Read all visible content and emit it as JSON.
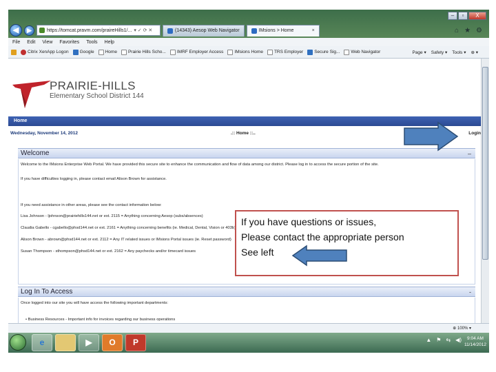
{
  "window": {
    "minimize": "–",
    "restore": "▫",
    "close": "X"
  },
  "toolbar": {
    "back": "◀",
    "forward": "▶",
    "address": "https://tomcat.pravm.com/praireHills1/...",
    "address_controls": "▾ ✓ ⟳ ✕",
    "tabs": [
      {
        "label": "(14343) Aesop Web Navigator",
        "close": ""
      },
      {
        "label": "IMsions > Home",
        "close": "×"
      }
    ],
    "right_icons": [
      "⌂",
      "★",
      "⚙"
    ]
  },
  "menubar": [
    "File",
    "Edit",
    "View",
    "Favorites",
    "Tools",
    "Help"
  ],
  "favorites": [
    "Citrix XenApp Logon",
    "Google",
    "Home",
    "Prairie Hills Scho...",
    "IMRF Employer Access",
    "IMsions Home",
    "TRS Employer",
    "Secure Sig...",
    "Web Navigator"
  ],
  "commandbar": [
    "Page ▾",
    "Safety ▾",
    "Tools ▾",
    "⊕ ▾"
  ],
  "page": {
    "logo_line1": "PRAIRIE-HILLS",
    "logo_line2": "Elementary School District 144",
    "home_bar": "Home",
    "date": "Wednesday, November 14, 2012",
    "crumb": ".:: Home ::..",
    "login_link": "Login",
    "welcome": {
      "title": "Welcome",
      "control": "–",
      "lines": [
        "Welcome to the IMsions Enterprise Web Portal. We have provided this secure site to enhance the communication and flow of data among our district. Please log in to access the secure portion of the site.",
        "If you have difficulties logging in, please contact email Alison Brown for assistance.",
        "If you need assistance in other areas, please see the contact information below:",
        "Lisa Johnson - ljohnson@prairiehills144.net or ext. 2115 = Anything concerning Aesop (subs/absences)",
        "Claudia Gabello - cgabello@phsd144.net or ext. 2161 = Anything concerning benefits (ie. Medical, Dental, Vision or 403b)",
        "Alison Brown - abrown@phsd144.net or ext. 2112 = Any IT related issues or IMsions Portal issues (ie. Reset password)",
        "Susan Thompson - sthompson@phsd144.net or ext. 2162 = Any paychecks and/or timecard issues"
      ]
    },
    "login_panel": {
      "title": "Log In To Access",
      "control": "-",
      "lines": [
        "Once logged into our site you will have access the following important departments:",
        "•  Business Resources - Important info for invoices regarding our business operations"
      ]
    }
  },
  "statusbar": {
    "zoom": "⊕ 100% ▾"
  },
  "taskbar": {
    "tray": [
      "▲",
      "⚑",
      "⇆",
      "◀)"
    ],
    "time": "9:04 AM",
    "date": "11/14/2012"
  },
  "overlay": {
    "note_lines": [
      "If you have questions or issues,",
      "Please contact the appropriate person",
      "See left"
    ],
    "arrow_fill": "#4f81bd",
    "arrow_stroke": "#2c4d75",
    "box_border": "#c0504d"
  }
}
